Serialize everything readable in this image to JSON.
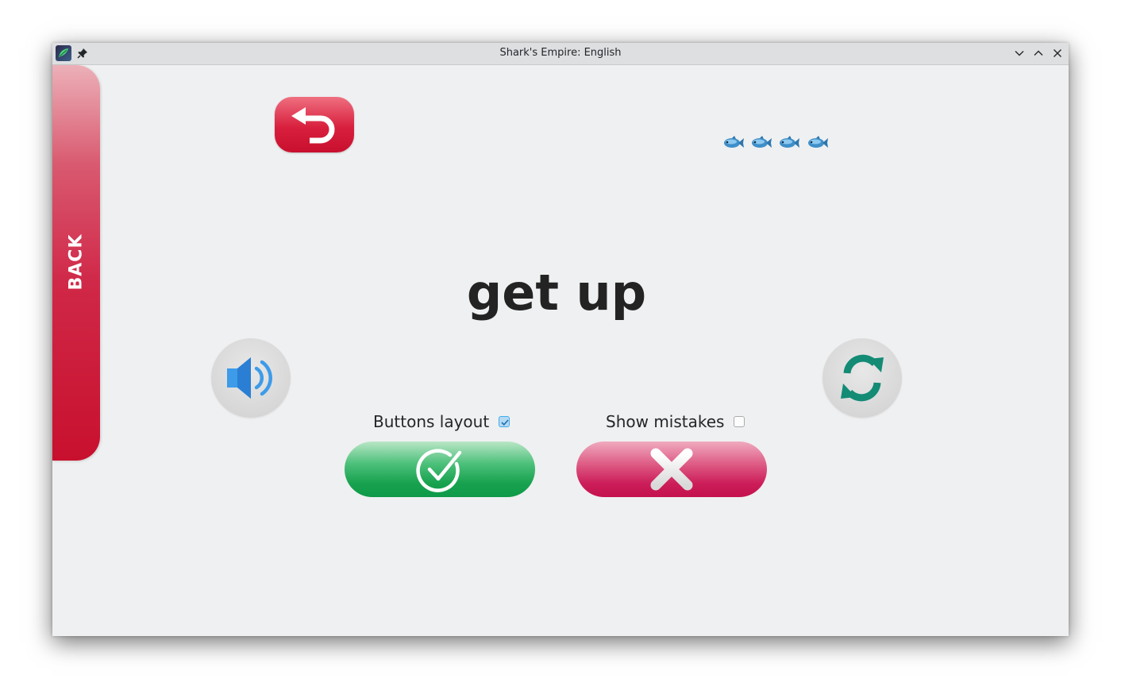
{
  "window": {
    "title": "Shark's Empire: English"
  },
  "sidebar": {
    "back_label": "BACK"
  },
  "game": {
    "word": "get up",
    "lives": 4,
    "fish_icons": [
      "fish-icon",
      "fish-icon",
      "fish-icon",
      "fish-icon"
    ]
  },
  "options": {
    "buttons_layout_label": "Buttons layout",
    "buttons_layout_checked": true,
    "show_mistakes_label": "Show mistakes",
    "show_mistakes_checked": false
  },
  "colors": {
    "back_red": "#c8102e",
    "correct_green": "#18a24f",
    "wrong_pink": "#cc1e5a",
    "sound_blue": "#2d8de8",
    "refresh_teal": "#138b75"
  }
}
